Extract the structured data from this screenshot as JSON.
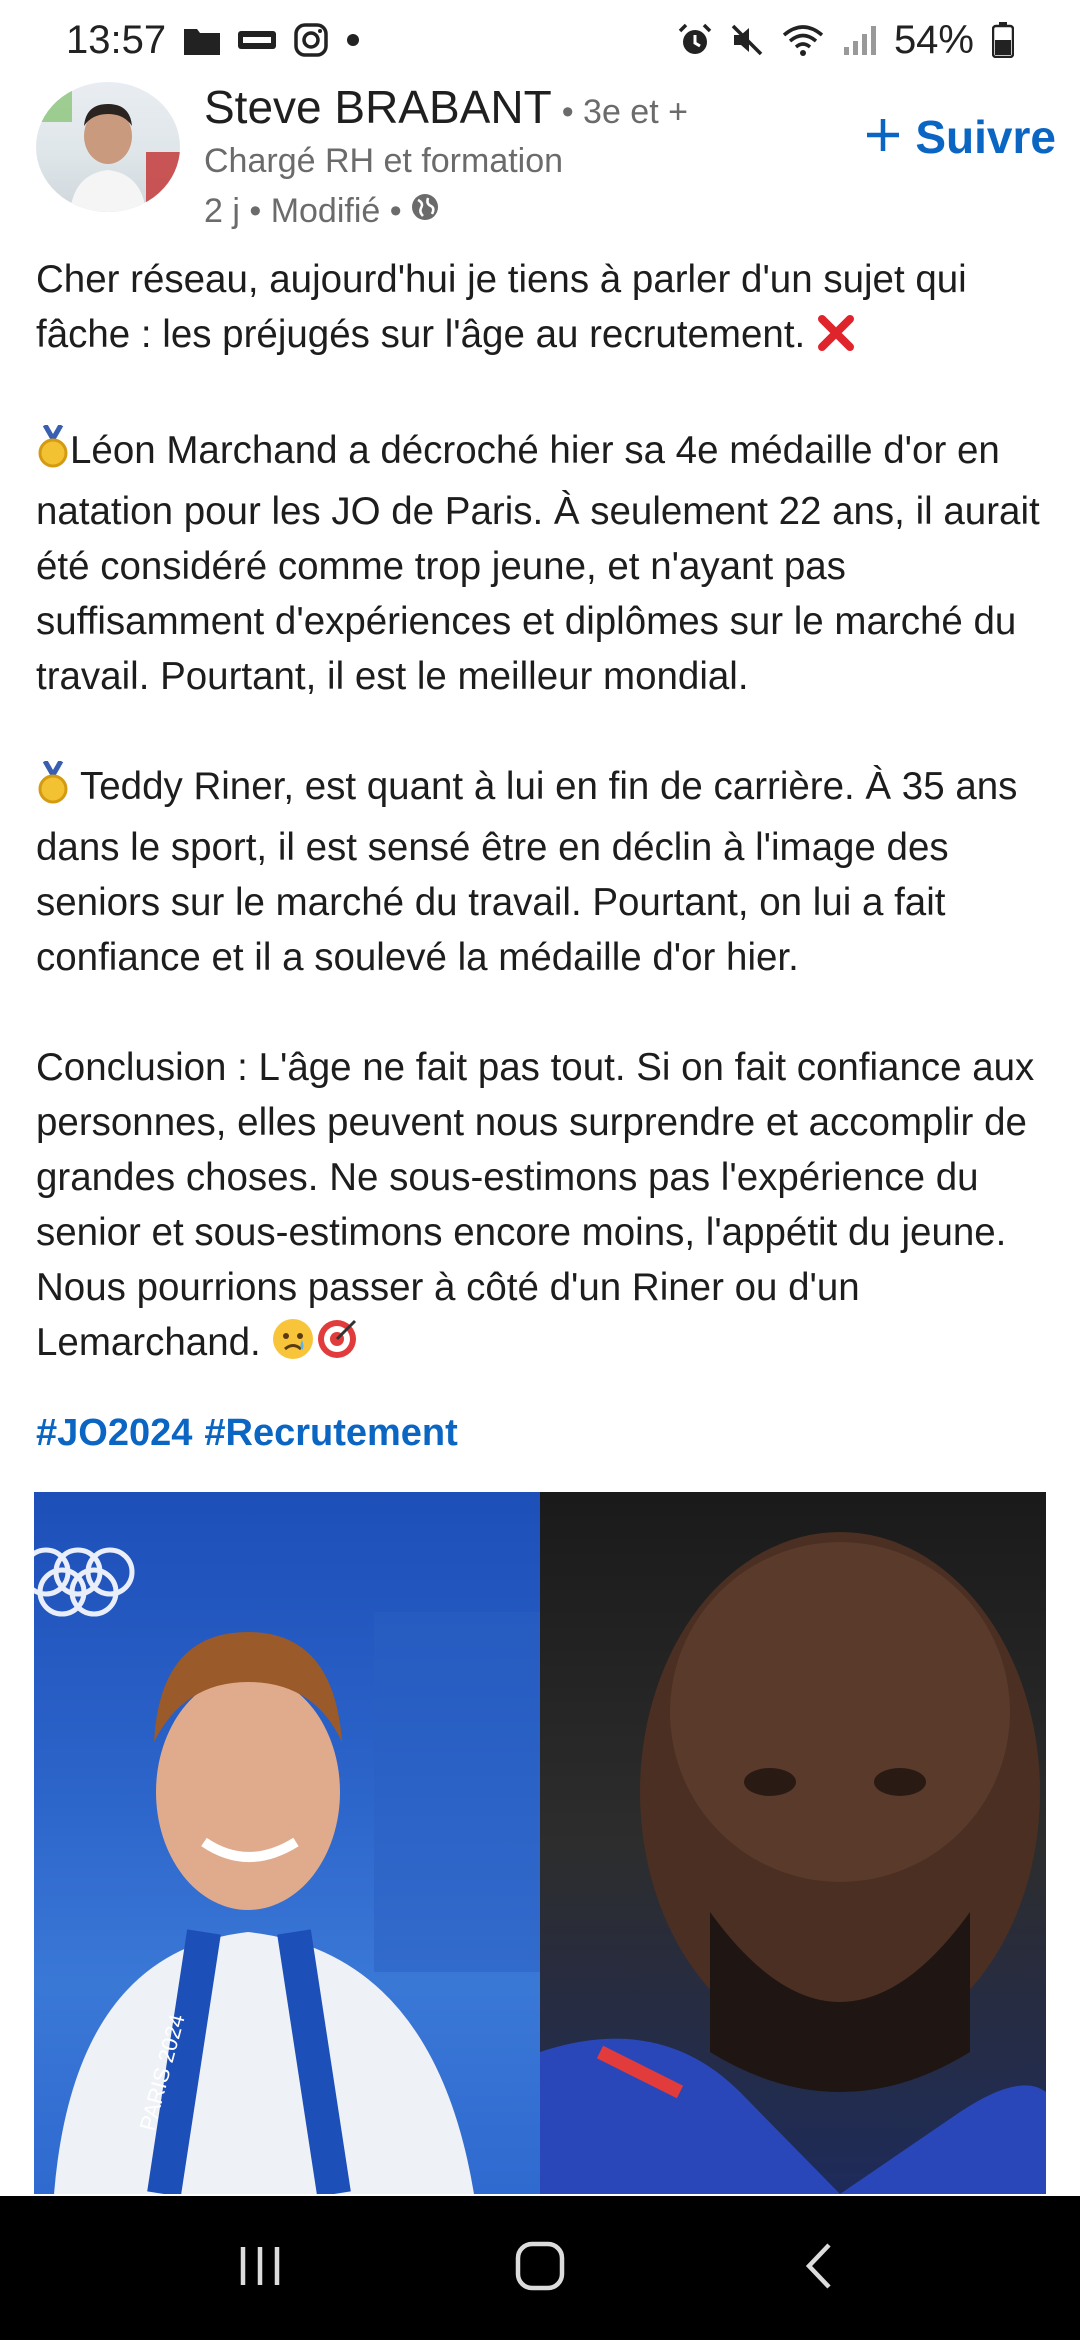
{
  "status_bar": {
    "time": "13:57",
    "battery": "54%",
    "left_icons": [
      "folder-icon",
      "levis-icon",
      "instagram-icon",
      "dot-icon"
    ],
    "right_icons": [
      "alarm-icon",
      "mute-icon",
      "wifi-icon",
      "signal-icon",
      "battery-icon"
    ]
  },
  "author": {
    "name": "Steve BRABANT",
    "degree": "• 3e et +",
    "headline": "Chargé RH et formation",
    "meta": "2 j • Modifié •",
    "follow_label": "Suivre"
  },
  "post": {
    "paragraphs": [
      "Cher réseau, aujourd'hui je tiens à parler d'un sujet qui fâche : les préjugés sur l'âge au recrutement.",
      "Léon Marchand a décroché hier sa 4e médaille d'or en natation pour les JO de Paris. À seulement 22 ans, il aurait été considéré comme trop jeune, et n'ayant pas suffisamment d'expériences et diplômes sur le marché du travail. Pourtant, il est le meilleur mondial.",
      "Teddy Riner, est quant à lui en fin de carrière. À 35 ans dans le sport, il est sensé être en déclin à l'image des seniors sur le marché du travail. Pourtant, on lui a fait confiance et il a soulevé la médaille d'or hier.",
      "Conclusion : L'âge ne fait pas tout. Si on fait confiance aux personnes, elles peuvent nous surprendre et accomplir de grandes choses. Ne sous-estimons pas l'expérience du senior et sous-estimons encore moins, l'appétit du jeune. Nous pourrions passer à côté d'un Riner ou d'un Lemarchand."
    ],
    "emojis": [
      "cross-mark-icon",
      "gold-medal-icon",
      "gold-medal-icon",
      "sad-face-icon",
      "target-icon"
    ],
    "hashtags": [
      "#JO2024",
      "#Recrutement"
    ]
  },
  "image": {
    "left_description_icon": "swimmer-photo",
    "right_description_icon": "judoka-photo",
    "medal_ribbon_text": "PARIS 2024"
  },
  "nav_bar": {
    "buttons": [
      "recents-icon",
      "home-icon",
      "back-icon"
    ]
  },
  "colors": {
    "accent": "#0a66c2",
    "text": "#1d1d1d",
    "muted": "#6b6b6b",
    "nav_bg": "#000000"
  }
}
